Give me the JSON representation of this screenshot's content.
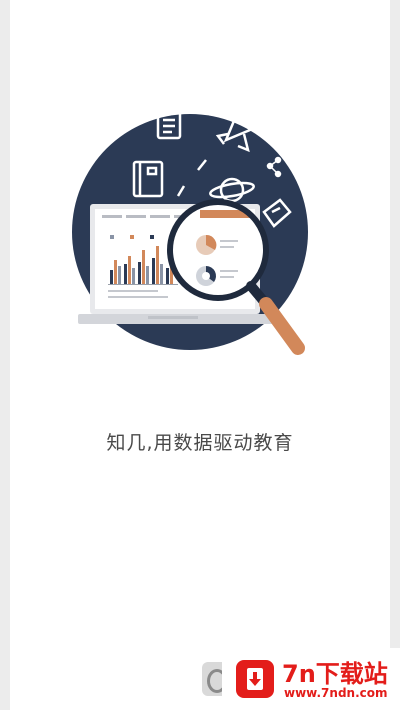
{
  "onboarding": {
    "tagline": "知几,用数据驱动教育",
    "illustration_icon": "magnifier-over-laptop-with-charts",
    "colors": {
      "circle": "#2b3a55",
      "accent_orange": "#d2885a",
      "background": "#ffffff"
    }
  },
  "watermark": {
    "title": "7n下载站",
    "url": "www.7ndn.com",
    "logo_icon": "download-arrow-icon"
  }
}
